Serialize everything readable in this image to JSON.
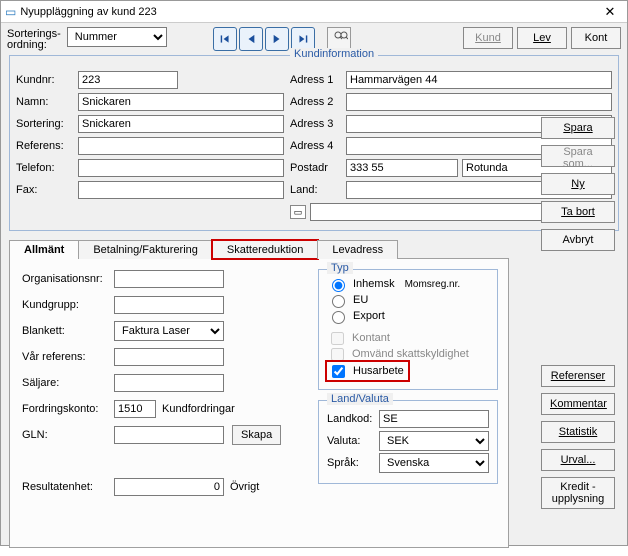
{
  "window": {
    "title": "Nyuppläggning av kund 223"
  },
  "sort": {
    "label1": "Sorterings-",
    "label2": "ordning:",
    "value": "Nummer"
  },
  "topButtons": {
    "kund": "Kund",
    "lev": "Lev",
    "kont": "Kont"
  },
  "kundinfo": {
    "legend": "Kundinformation",
    "kundnr_label": "Kundnr:",
    "kundnr": "223",
    "namn_label": "Namn:",
    "namn": "Snickaren",
    "sortering_label": "Sortering:",
    "sortering": "Snickaren",
    "referens_label": "Referens:",
    "referens": "",
    "telefon_label": "Telefon:",
    "telefon": "",
    "fax_label": "Fax:",
    "fax": "",
    "adress1_label": "Adress 1",
    "adress1": "Hammarvägen 44",
    "adress2_label": "Adress 2",
    "adress2": "",
    "adress3_label": "Adress 3",
    "adress3": "",
    "adress4_label": "Adress 4",
    "adress4": "",
    "postadr_label": "Postadr",
    "postnr": "333 55",
    "postort": "Rotunda",
    "land_label": "Land:",
    "land": ""
  },
  "sideButtons": {
    "spara": "Spara",
    "spara_som": "Spara som...",
    "ny": "Ny",
    "ta_bort": "Ta bort",
    "avbryt": "Avbryt"
  },
  "sideButtons2": {
    "referenser": "Referenser",
    "kommentar": "Kommentar",
    "statistik": "Statistik",
    "urval": "Urval...",
    "kredit1": "Kredit -",
    "kredit2": "upplysning"
  },
  "tabs": {
    "allmant": "Allmänt",
    "betalning": "Betalning/Fakturering",
    "skattered": "Skattereduktion",
    "levadress": "Levadress"
  },
  "allmant": {
    "orgnr_label": "Organisationsnr:",
    "orgnr": "",
    "kundgrupp_label": "Kundgrupp:",
    "kundgrupp": "",
    "blankett_label": "Blankett:",
    "blankett": "Faktura Laser",
    "varref_label": "Vår referens:",
    "varref": "",
    "saljare_label": "Säljare:",
    "saljare": "",
    "fordkonto_label": "Fordringskonto:",
    "fordkonto": "1510",
    "fordkonto_desc": "Kundfordringar",
    "gln_label": "GLN:",
    "gln": "",
    "skapa": "Skapa",
    "resultatenhet_label": "Resultatenhet:",
    "resultatenhet": "0",
    "resultatenhet_desc": "Övrigt"
  },
  "typ": {
    "legend": "Typ",
    "inhemsk": "Inhemsk",
    "momsreg": "Momsreg.nr.",
    "eu": "EU",
    "export": "Export",
    "kontant": "Kontant",
    "omvand": "Omvänd skattskyldighet",
    "husarbete": "Husarbete"
  },
  "landvaluta": {
    "legend": "Land/Valuta",
    "landkod_label": "Landkod:",
    "landkod": "SE",
    "valuta_label": "Valuta:",
    "valuta": "SEK",
    "sprak_label": "Språk:",
    "sprak": "Svenska"
  }
}
